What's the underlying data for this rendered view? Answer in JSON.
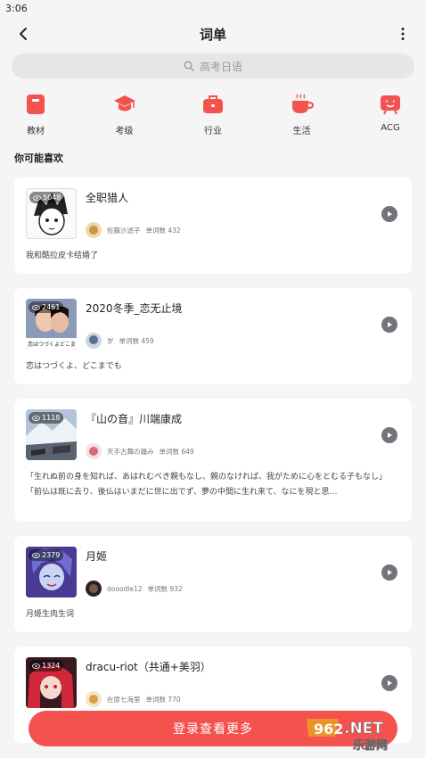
{
  "status_bar": {
    "time": "3:06"
  },
  "nav": {
    "title": "词单"
  },
  "search": {
    "placeholder": "高考日语"
  },
  "categories": [
    {
      "label": "教材",
      "icon": "book-icon"
    },
    {
      "label": "考级",
      "icon": "graduation-cap-icon"
    },
    {
      "label": "行业",
      "icon": "briefcase-icon"
    },
    {
      "label": "生活",
      "icon": "coffee-cup-icon"
    },
    {
      "label": "ACG",
      "icon": "tv-icon"
    }
  ],
  "section_title": "你可能喜欢",
  "cards": [
    {
      "title": "全职猎人",
      "views": "5048",
      "author": "佐藤沙滤子",
      "word_count": "单词数 432",
      "desc": [
        "我和酷拉皮卡结婚了"
      ]
    },
    {
      "title": "2020冬季_恋无止境",
      "views": "2461",
      "author": "岁",
      "word_count": "单词数 459",
      "desc": [
        "恋はつづくよ、どこまでも"
      ],
      "thumb_caption": "恋はつづくよどこまで"
    },
    {
      "title": "『山の音』川端康成",
      "views": "1118",
      "author": "天手古舞の踊み",
      "word_count": "单词数 649",
      "desc": [
        "「生れぬ前の身を知れば、あはれむべき親もなし、親のなければ、我がために心をとむる子もなし」",
        "「前仏は既に去り、後仏はいまだに世に出でず、夢の中間に生れ来て、なにを現と思…"
      ]
    },
    {
      "title": "月姬",
      "views": "2379",
      "author": "dooodle12",
      "word_count": "单词数 932",
      "desc": [
        "月姬生肉生词"
      ]
    },
    {
      "title": "dracu-riot（共通+美羽）",
      "views": "1324",
      "author": "在原七海里",
      "word_count": "单词数 770",
      "desc": []
    }
  ],
  "login_button": "登录查看更多",
  "watermark": {
    "main": "962.NET",
    "sub": "乐游网"
  },
  "colors": {
    "accent": "#f4524f",
    "background": "#f5f5f5",
    "play": "#777279"
  }
}
